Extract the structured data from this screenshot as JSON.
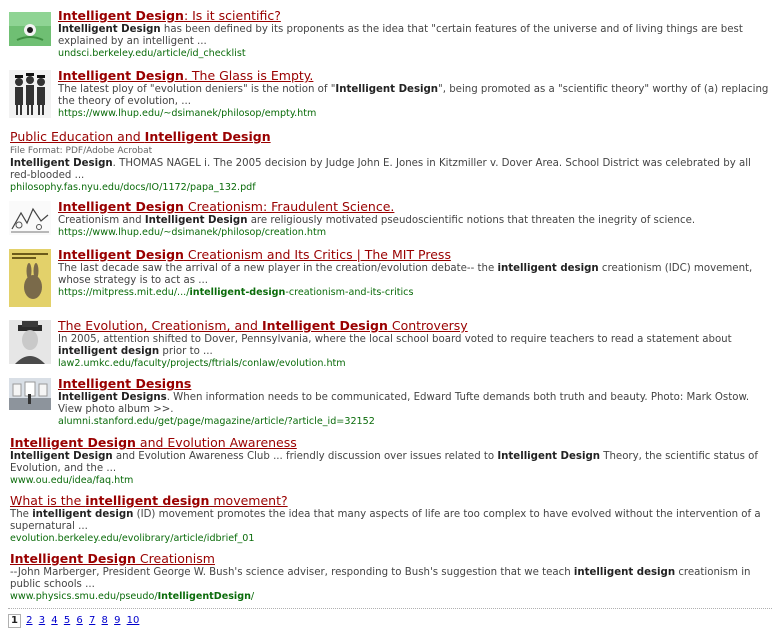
{
  "results": [
    {
      "title_parts": [
        {
          "t": "Intelligent Design",
          "b": true
        },
        {
          "t": ": Is it scientific?",
          "b": false
        }
      ],
      "snippet_parts": [
        {
          "t": "Intelligent Design",
          "b": true
        },
        {
          "t": " has been defined by its proponents as the idea that \"certain features of the universe and of living things are best explained by an intelligent ...",
          "b": false
        }
      ],
      "url_parts": [
        {
          "t": "undsci.berkeley.edu/article/id_checklist",
          "b": false
        }
      ],
      "thumbnail": "green-creature-thumbnail"
    },
    {
      "title_parts": [
        {
          "t": "Intelligent Design",
          "b": true
        },
        {
          "t": ". The Glass is Empty.",
          "b": false
        }
      ],
      "snippet_parts": [
        {
          "t": "The latest ploy of \"evolution deniers\" is the notion of \"",
          "b": false
        },
        {
          "t": "Intelligent Design",
          "b": true
        },
        {
          "t": "\", being promoted as a \"scientific theory\" worthy of (a) replacing the theory of evolution, ...",
          "b": false
        }
      ],
      "url_parts": [
        {
          "t": "https://www.lhup.edu/~dsimanek/philosop/empty.htm",
          "b": false
        }
      ],
      "thumbnail": "three-figures-thumbnail"
    },
    {
      "title_parts": [
        {
          "t": "Public Education and ",
          "b": false
        },
        {
          "t": "Intelligent Design",
          "b": true
        }
      ],
      "meta": "File Format: PDF/Adobe Acrobat",
      "snippet_parts": [
        {
          "t": "Intelligent Design",
          "b": true
        },
        {
          "t": ". THOMAS NAGEL i. The 2005 decision by Judge John E. Jones in Kitzmiller v. Dover Area. School District was celebrated by all red-blooded ...",
          "b": false
        }
      ],
      "url_parts": [
        {
          "t": "philosophy.fas.nyu.edu/docs/IO/1172/papa_132.pdf",
          "b": false
        }
      ],
      "thumbnail": ""
    },
    {
      "title_parts": [
        {
          "t": "Intelligent Design",
          "b": true
        },
        {
          "t": " Creationism: Fraudulent Science.",
          "b": false
        }
      ],
      "snippet_parts": [
        {
          "t": "Creationism and ",
          "b": false
        },
        {
          "t": "Intelligent Design",
          "b": true
        },
        {
          "t": " are religiously motivated pseudoscientific notions that threaten the inegrity of science.",
          "b": false
        }
      ],
      "url_parts": [
        {
          "t": "https://www.lhup.edu/~dsimanek/philosop/creation.htm",
          "b": false
        }
      ],
      "thumbnail": "cartoon-sketch-thumbnail"
    },
    {
      "title_parts": [
        {
          "t": "Intelligent Design",
          "b": true
        },
        {
          "t": " Creationism and Its Critics | The MIT Press",
          "b": false
        }
      ],
      "snippet_parts": [
        {
          "t": "The last decade saw the arrival of a new player in the creation/evolution debate-- the ",
          "b": false
        },
        {
          "t": "intelligent design",
          "b": true
        },
        {
          "t": " creationism (IDC) movement, whose strategy is to act as ...",
          "b": false
        }
      ],
      "url_parts": [
        {
          "t": "https://mitpress.mit.edu/.../",
          "b": false
        },
        {
          "t": "intelligent-design",
          "b": true
        },
        {
          "t": "-creationism-and-its-critics",
          "b": false
        }
      ],
      "thumbnail": "book-cover-thumbnail"
    },
    {
      "title_parts": [
        {
          "t": "The Evolution, Creationism, and ",
          "b": false
        },
        {
          "t": "Intelligent Design",
          "b": true
        },
        {
          "t": " Controversy",
          "b": false
        }
      ],
      "snippet_parts": [
        {
          "t": "In 2005, attention shifted to Dover, Pennsylvania, where the local school board voted to require teachers to read a statement about ",
          "b": false
        },
        {
          "t": "intelligent design",
          "b": true
        },
        {
          "t": " prior to ...",
          "b": false
        }
      ],
      "url_parts": [
        {
          "t": "law2.umkc.edu/faculty/projects/ftrials/conlaw/evolution.htm",
          "b": false
        }
      ],
      "thumbnail": "portrait-photo-thumbnail"
    },
    {
      "title_parts": [
        {
          "t": "Intelligent Designs",
          "b": true
        }
      ],
      "snippet_parts": [
        {
          "t": "Intelligent Designs",
          "b": true
        },
        {
          "t": ". When information needs to be communicated, Edward Tufte demands both truth and beauty. Photo: Mark Ostow. View photo album >>.",
          "b": false
        }
      ],
      "url_parts": [
        {
          "t": "alumni.stanford.edu/get/page/magazine/article/?article_id=32152",
          "b": false
        }
      ],
      "thumbnail": "gallery-photo-thumbnail"
    },
    {
      "title_parts": [
        {
          "t": "Intelligent Design",
          "b": true
        },
        {
          "t": " and Evolution Awareness",
          "b": false
        }
      ],
      "snippet_parts": [
        {
          "t": "Intelligent Design",
          "b": true
        },
        {
          "t": " and Evolution Awareness Club ... friendly discussion over issues related to ",
          "b": false
        },
        {
          "t": "Intelligent Design",
          "b": true
        },
        {
          "t": " Theory, the scientific status of Evolution, and the ...",
          "b": false
        }
      ],
      "url_parts": [
        {
          "t": "www.ou.edu/idea/faq.htm",
          "b": false
        }
      ],
      "thumbnail": ""
    },
    {
      "title_parts": [
        {
          "t": "What is the ",
          "b": false
        },
        {
          "t": "intelligent design",
          "b": true
        },
        {
          "t": " movement?",
          "b": false
        }
      ],
      "snippet_parts": [
        {
          "t": "The ",
          "b": false
        },
        {
          "t": "intelligent design",
          "b": true
        },
        {
          "t": " (ID) movement promotes the idea that many aspects of life are too complex to have evolved without the intervention of a supernatural ...",
          "b": false
        }
      ],
      "url_parts": [
        {
          "t": "evolution.berkeley.edu/evolibrary/article/idbrief_01",
          "b": false
        }
      ],
      "thumbnail": ""
    },
    {
      "title_parts": [
        {
          "t": "Intelligent Design",
          "b": true
        },
        {
          "t": " Creationism",
          "b": false
        }
      ],
      "snippet_parts": [
        {
          "t": "--John Marberger, President George W. Bush's science adviser, responding to Bush's suggestion that we teach ",
          "b": false
        },
        {
          "t": "intelligent design",
          "b": true
        },
        {
          "t": " creationism in public schools ...",
          "b": false
        }
      ],
      "url_parts": [
        {
          "t": "www.physics.smu.edu/pseudo/",
          "b": false
        },
        {
          "t": "IntelligentDesign",
          "b": true
        },
        {
          "t": "/",
          "b": false
        }
      ],
      "thumbnail": ""
    }
  ],
  "pagination": {
    "current": "1",
    "pages": [
      "2",
      "3",
      "4",
      "5",
      "6",
      "7",
      "8",
      "9",
      "10"
    ]
  },
  "colors": {
    "title": "#990000",
    "url": "#0a6b0a",
    "snippet": "#444444",
    "page_link": "#0000cc"
  }
}
